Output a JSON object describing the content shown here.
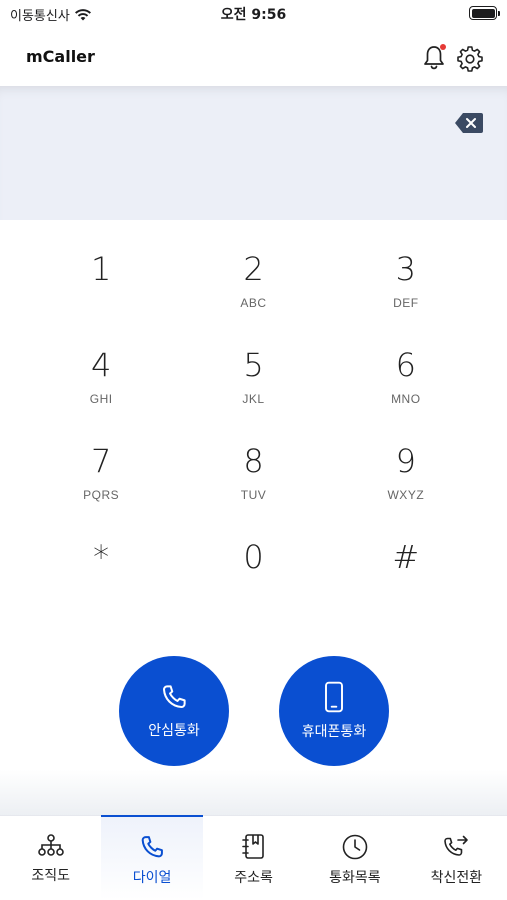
{
  "status_bar": {
    "carrier": "이동통신사",
    "time": "오전 9:56"
  },
  "header": {
    "title": "mCaller",
    "has_notification": true
  },
  "dial_input": {
    "number": ""
  },
  "keypad": [
    {
      "digit": "1",
      "letters": ""
    },
    {
      "digit": "2",
      "letters": "ABC"
    },
    {
      "digit": "3",
      "letters": "DEF"
    },
    {
      "digit": "4",
      "letters": "GHI"
    },
    {
      "digit": "5",
      "letters": "JKL"
    },
    {
      "digit": "6",
      "letters": "MNO"
    },
    {
      "digit": "7",
      "letters": "PQRS"
    },
    {
      "digit": "8",
      "letters": "TUV"
    },
    {
      "digit": "9",
      "letters": "WXYZ"
    },
    {
      "digit": "*",
      "letters": ""
    },
    {
      "digit": "0",
      "letters": ""
    },
    {
      "digit": "#",
      "letters": ""
    }
  ],
  "call_buttons": {
    "safe_call": "안심통화",
    "mobile_call": "휴대폰통화"
  },
  "tabs": [
    {
      "label": "조직도",
      "icon": "org-chart-icon",
      "active": false
    },
    {
      "label": "다이얼",
      "icon": "phone-icon",
      "active": true
    },
    {
      "label": "주소록",
      "icon": "address-book-icon",
      "active": false
    },
    {
      "label": "통화목록",
      "icon": "clock-icon",
      "active": false
    },
    {
      "label": "착신전환",
      "icon": "call-forward-icon",
      "active": false
    }
  ],
  "colors": {
    "accent": "#0a4fd1",
    "input_background": "#eceff7",
    "notification_dot": "#e53935"
  }
}
